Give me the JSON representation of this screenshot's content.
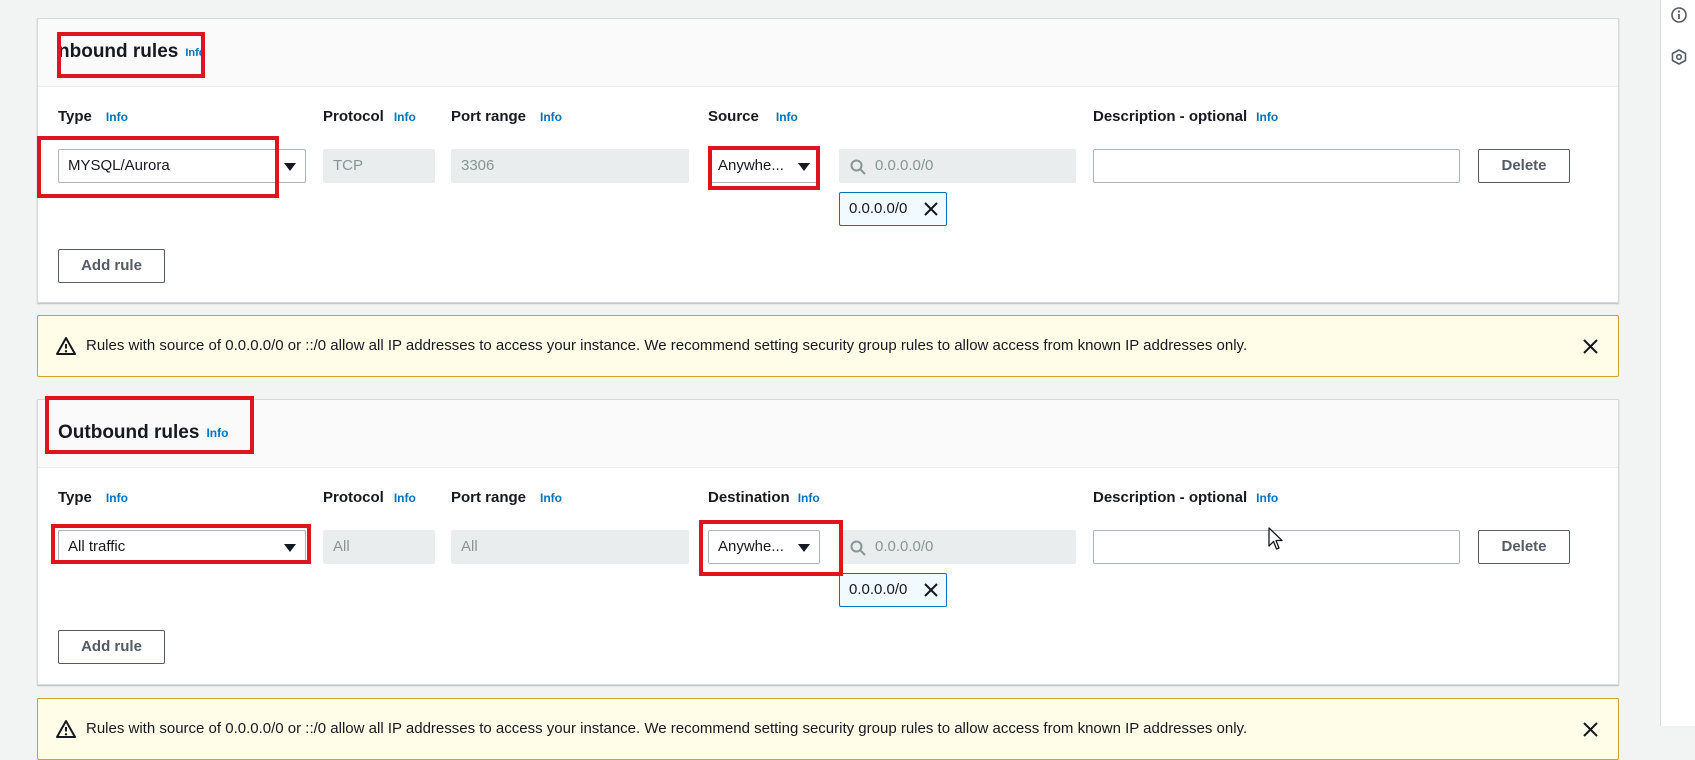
{
  "inbound": {
    "title": "nbound rules",
    "info": "Info",
    "headers": {
      "type": "Type",
      "protocol": "Protocol",
      "port_range": "Port range",
      "source": "Source",
      "description": "Description - optional",
      "info": "Info"
    },
    "rule": {
      "type": "MYSQL/Aurora",
      "protocol": "TCP",
      "port_range": "3306",
      "source": "Anywhe...",
      "cidr_placeholder": "0.0.0.0/0",
      "cidr_chip": "0.0.0.0/0",
      "description": "",
      "delete_label": "Delete"
    },
    "add_rule_label": "Add rule"
  },
  "warning": {
    "text": "Rules with source of 0.0.0.0/0 or ::/0 allow all IP addresses to access your instance. We recommend setting security group rules to allow access from known IP addresses only."
  },
  "outbound": {
    "title": "Outbound rules",
    "info": "Info",
    "headers": {
      "type": "Type",
      "protocol": "Protocol",
      "port_range": "Port range",
      "destination": "Destination",
      "description": "Description - optional",
      "info": "Info"
    },
    "rule": {
      "type": "All traffic",
      "protocol": "All",
      "port_range": "All",
      "destination": "Anywhe...",
      "cidr_placeholder": "0.0.0.0/0",
      "cidr_chip": "0.0.0.0/0",
      "description": "",
      "delete_label": "Delete"
    },
    "add_rule_label": "Add rule"
  },
  "icons": {
    "rightbar": [
      "info-circle-icon",
      "shield-settings-icon"
    ],
    "warning": "warning-triangle-icon",
    "close": "close-icon",
    "search": "search-icon"
  },
  "colors": {
    "link": "#0073bb",
    "highlight": "#e0141e",
    "warning_bg": "#fffce7",
    "warning_border": "#c8a233",
    "chip_bg": "#f1faff"
  }
}
